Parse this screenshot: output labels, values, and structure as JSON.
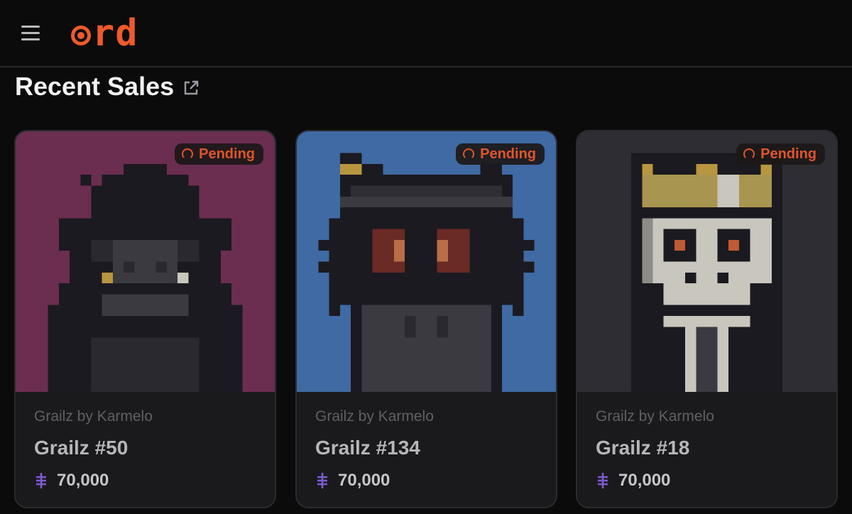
{
  "app": {
    "logo_text": "rd",
    "logo_color": "#ef5a2a"
  },
  "section": {
    "title": "Recent Sales"
  },
  "status_badge_color": "#e0552a",
  "cards": [
    {
      "status": "Pending",
      "collection": "Grailz by Karmelo",
      "name": "Grailz #50",
      "price": "70,000",
      "background": "#6b2d50",
      "art": "gorilla"
    },
    {
      "status": "Pending",
      "collection": "Grailz by Karmelo",
      "name": "Grailz #134",
      "price": "70,000",
      "background": "#3f6aa3",
      "art": "cat-robot"
    },
    {
      "status": "Pending",
      "collection": "Grailz by Karmelo",
      "name": "Grailz #18",
      "price": "70,000",
      "background": "#2d2d33",
      "art": "skeleton-king"
    }
  ]
}
